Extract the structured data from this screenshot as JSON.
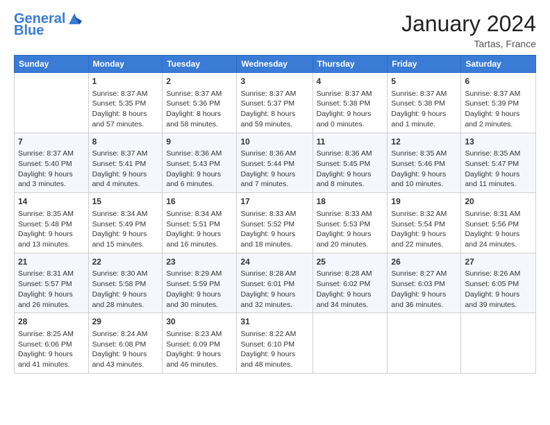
{
  "header": {
    "logo_line1": "General",
    "logo_line2": "Blue",
    "month_title": "January 2024",
    "location": "Tartas, France"
  },
  "days_of_week": [
    "Sunday",
    "Monday",
    "Tuesday",
    "Wednesday",
    "Thursday",
    "Friday",
    "Saturday"
  ],
  "weeks": [
    [
      {
        "day": "",
        "sunrise": "",
        "sunset": "",
        "daylight": ""
      },
      {
        "day": "1",
        "sunrise": "Sunrise: 8:37 AM",
        "sunset": "Sunset: 5:35 PM",
        "daylight": "Daylight: 8 hours and 57 minutes."
      },
      {
        "day": "2",
        "sunrise": "Sunrise: 8:37 AM",
        "sunset": "Sunset: 5:36 PM",
        "daylight": "Daylight: 8 hours and 58 minutes."
      },
      {
        "day": "3",
        "sunrise": "Sunrise: 8:37 AM",
        "sunset": "Sunset: 5:37 PM",
        "daylight": "Daylight: 8 hours and 59 minutes."
      },
      {
        "day": "4",
        "sunrise": "Sunrise: 8:37 AM",
        "sunset": "Sunset: 5:38 PM",
        "daylight": "Daylight: 9 hours and 0 minutes."
      },
      {
        "day": "5",
        "sunrise": "Sunrise: 8:37 AM",
        "sunset": "Sunset: 5:38 PM",
        "daylight": "Daylight: 9 hours and 1 minute."
      },
      {
        "day": "6",
        "sunrise": "Sunrise: 8:37 AM",
        "sunset": "Sunset: 5:39 PM",
        "daylight": "Daylight: 9 hours and 2 minutes."
      }
    ],
    [
      {
        "day": "7",
        "sunrise": "Sunrise: 8:37 AM",
        "sunset": "Sunset: 5:40 PM",
        "daylight": "Daylight: 9 hours and 3 minutes."
      },
      {
        "day": "8",
        "sunrise": "Sunrise: 8:37 AM",
        "sunset": "Sunset: 5:41 PM",
        "daylight": "Daylight: 9 hours and 4 minutes."
      },
      {
        "day": "9",
        "sunrise": "Sunrise: 8:36 AM",
        "sunset": "Sunset: 5:43 PM",
        "daylight": "Daylight: 9 hours and 6 minutes."
      },
      {
        "day": "10",
        "sunrise": "Sunrise: 8:36 AM",
        "sunset": "Sunset: 5:44 PM",
        "daylight": "Daylight: 9 hours and 7 minutes."
      },
      {
        "day": "11",
        "sunrise": "Sunrise: 8:36 AM",
        "sunset": "Sunset: 5:45 PM",
        "daylight": "Daylight: 9 hours and 8 minutes."
      },
      {
        "day": "12",
        "sunrise": "Sunrise: 8:35 AM",
        "sunset": "Sunset: 5:46 PM",
        "daylight": "Daylight: 9 hours and 10 minutes."
      },
      {
        "day": "13",
        "sunrise": "Sunrise: 8:35 AM",
        "sunset": "Sunset: 5:47 PM",
        "daylight": "Daylight: 9 hours and 11 minutes."
      }
    ],
    [
      {
        "day": "14",
        "sunrise": "Sunrise: 8:35 AM",
        "sunset": "Sunset: 5:48 PM",
        "daylight": "Daylight: 9 hours and 13 minutes."
      },
      {
        "day": "15",
        "sunrise": "Sunrise: 8:34 AM",
        "sunset": "Sunset: 5:49 PM",
        "daylight": "Daylight: 9 hours and 15 minutes."
      },
      {
        "day": "16",
        "sunrise": "Sunrise: 8:34 AM",
        "sunset": "Sunset: 5:51 PM",
        "daylight": "Daylight: 9 hours and 16 minutes."
      },
      {
        "day": "17",
        "sunrise": "Sunrise: 8:33 AM",
        "sunset": "Sunset: 5:52 PM",
        "daylight": "Daylight: 9 hours and 18 minutes."
      },
      {
        "day": "18",
        "sunrise": "Sunrise: 8:33 AM",
        "sunset": "Sunset: 5:53 PM",
        "daylight": "Daylight: 9 hours and 20 minutes."
      },
      {
        "day": "19",
        "sunrise": "Sunrise: 8:32 AM",
        "sunset": "Sunset: 5:54 PM",
        "daylight": "Daylight: 9 hours and 22 minutes."
      },
      {
        "day": "20",
        "sunrise": "Sunrise: 8:31 AM",
        "sunset": "Sunset: 5:56 PM",
        "daylight": "Daylight: 9 hours and 24 minutes."
      }
    ],
    [
      {
        "day": "21",
        "sunrise": "Sunrise: 8:31 AM",
        "sunset": "Sunset: 5:57 PM",
        "daylight": "Daylight: 9 hours and 26 minutes."
      },
      {
        "day": "22",
        "sunrise": "Sunrise: 8:30 AM",
        "sunset": "Sunset: 5:58 PM",
        "daylight": "Daylight: 9 hours and 28 minutes."
      },
      {
        "day": "23",
        "sunrise": "Sunrise: 8:29 AM",
        "sunset": "Sunset: 5:59 PM",
        "daylight": "Daylight: 9 hours and 30 minutes."
      },
      {
        "day": "24",
        "sunrise": "Sunrise: 8:28 AM",
        "sunset": "Sunset: 6:01 PM",
        "daylight": "Daylight: 9 hours and 32 minutes."
      },
      {
        "day": "25",
        "sunrise": "Sunrise: 8:28 AM",
        "sunset": "Sunset: 6:02 PM",
        "daylight": "Daylight: 9 hours and 34 minutes."
      },
      {
        "day": "26",
        "sunrise": "Sunrise: 8:27 AM",
        "sunset": "Sunset: 6:03 PM",
        "daylight": "Daylight: 9 hours and 36 minutes."
      },
      {
        "day": "27",
        "sunrise": "Sunrise: 8:26 AM",
        "sunset": "Sunset: 6:05 PM",
        "daylight": "Daylight: 9 hours and 39 minutes."
      }
    ],
    [
      {
        "day": "28",
        "sunrise": "Sunrise: 8:25 AM",
        "sunset": "Sunset: 6:06 PM",
        "daylight": "Daylight: 9 hours and 41 minutes."
      },
      {
        "day": "29",
        "sunrise": "Sunrise: 8:24 AM",
        "sunset": "Sunset: 6:08 PM",
        "daylight": "Daylight: 9 hours and 43 minutes."
      },
      {
        "day": "30",
        "sunrise": "Sunrise: 8:23 AM",
        "sunset": "Sunset: 6:09 PM",
        "daylight": "Daylight: 9 hours and 46 minutes."
      },
      {
        "day": "31",
        "sunrise": "Sunrise: 8:22 AM",
        "sunset": "Sunset: 6:10 PM",
        "daylight": "Daylight: 9 hours and 48 minutes."
      },
      {
        "day": "",
        "sunrise": "",
        "sunset": "",
        "daylight": ""
      },
      {
        "day": "",
        "sunrise": "",
        "sunset": "",
        "daylight": ""
      },
      {
        "day": "",
        "sunrise": "",
        "sunset": "",
        "daylight": ""
      }
    ]
  ]
}
